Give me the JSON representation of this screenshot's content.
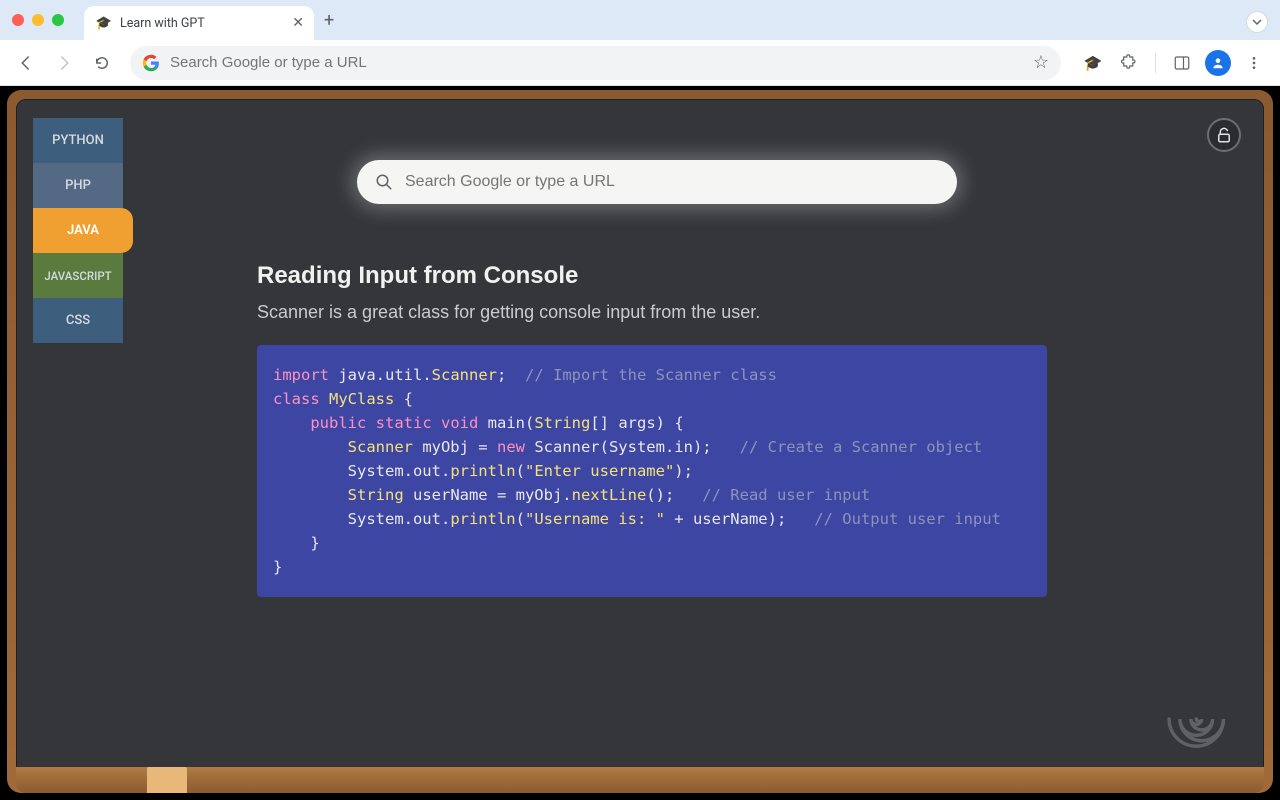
{
  "browser": {
    "tab_title": "Learn with GPT",
    "omnibox_placeholder": "Search Google or type a URL"
  },
  "sidebar": {
    "items": [
      "PYTHON",
      "PHP",
      "JAVA",
      "JAVASCRIPT",
      "CSS"
    ],
    "active": "JAVA"
  },
  "page_search": {
    "placeholder": "Search Google or type a URL"
  },
  "lesson": {
    "title": "Reading Input from Console",
    "subtitle": "Scanner is a great class for getting console input from the user."
  },
  "code": {
    "l1": {
      "a": "import",
      "b": " java.util.",
      "c": "Scanner",
      "d": ";",
      "cm": "// Import the Scanner class"
    },
    "l2": {
      "a": "class",
      "b": " MyClass ",
      "c": "{"
    },
    "l3": {
      "a": "public",
      "b": "static",
      "c": "void",
      "d": " main(",
      "e": "String",
      "f": "[] args) {"
    },
    "l4": {
      "a": "Scanner",
      "b": " myObj = ",
      "c": "new",
      "d": " Scanner(System.in);",
      "cm": "// Create a Scanner object"
    },
    "l5": {
      "a": "System.out.",
      "b": "println",
      "c": "(",
      "d": "\"Enter username\"",
      "e": ");"
    },
    "l6": {
      "a": "String",
      "b": " userName = myObj.",
      "c": "nextLine",
      "d": "();",
      "cm": "// Read user input"
    },
    "l7": {
      "a": "System.out.",
      "b": "println",
      "c": "(",
      "d": "\"Username is: \"",
      "e": " + userName);",
      "cm": "// Output user input"
    },
    "l8": "    }",
    "l9": "}"
  }
}
